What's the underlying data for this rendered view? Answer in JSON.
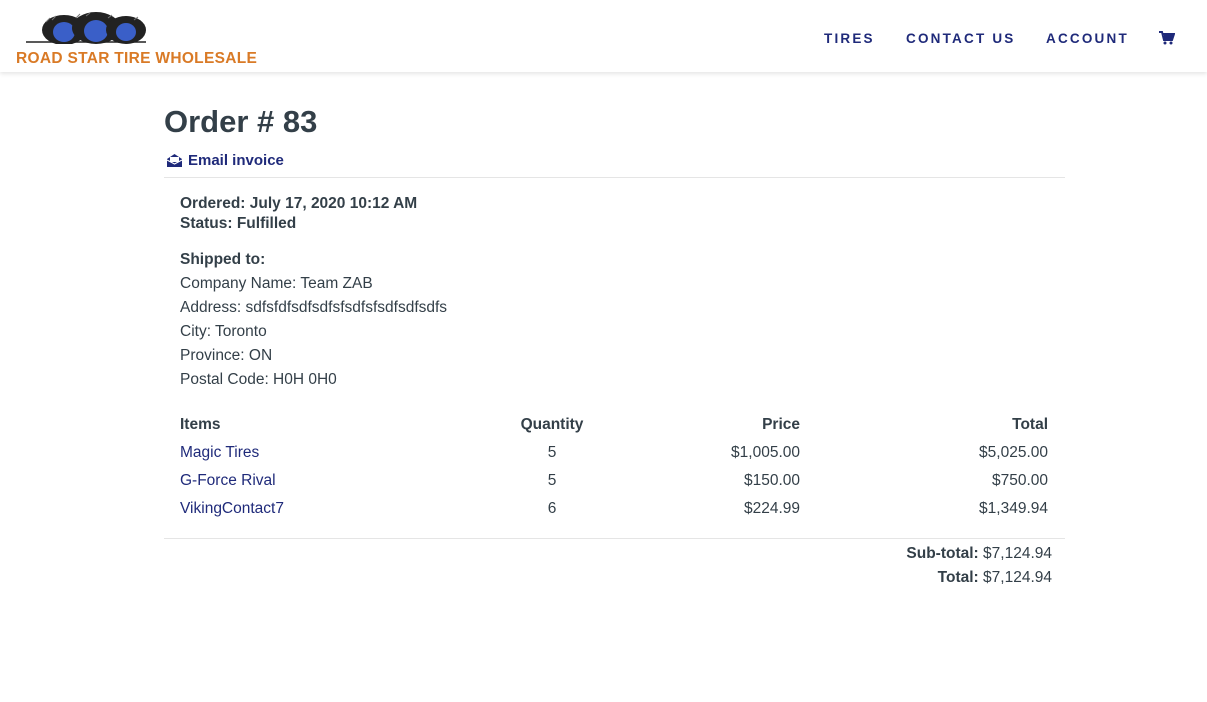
{
  "header": {
    "brand": "ROAD STAR TIRE WHOLESALE",
    "nav": {
      "tires": "TIRES",
      "contact": "CONTACT US",
      "account": "ACCOUNT"
    },
    "cart_icon": "shopping-cart-icon",
    "brand_color": "#d97a26",
    "nav_color": "#1f2a7a"
  },
  "order": {
    "title": "Order # 83",
    "email_invoice": "Email invoice",
    "email_icon": "envelope-open-icon",
    "ordered": "Ordered: July 17, 2020 10:12 AM",
    "status": "Status: Fulfilled"
  },
  "shipping": {
    "heading": "Shipped to:",
    "company": "Company Name: Team ZAB",
    "address": "Address: sdfsfdfsdfsdfsfsdfsfsdfsdfsdfs",
    "city": "City: Toronto",
    "province": "Province: ON",
    "postal": "Postal Code: H0H 0H0"
  },
  "table": {
    "headers": [
      "Items",
      "Quantity",
      "Price",
      "Total"
    ],
    "rows": [
      {
        "item": "Magic Tires",
        "qty": "5",
        "price": "$1,005.00",
        "total": "$5,025.00"
      },
      {
        "item": "G-Force Rival",
        "qty": "5",
        "price": "$150.00",
        "total": "$750.00"
      },
      {
        "item": "VikingContact7",
        "qty": "6",
        "price": "$224.99",
        "total": "$1,349.94"
      }
    ]
  },
  "summary": {
    "subtotal_label": "Sub-total:",
    "subtotal_value": "$7,124.94",
    "total_label": "Total:",
    "total_value": "$7,124.94"
  }
}
